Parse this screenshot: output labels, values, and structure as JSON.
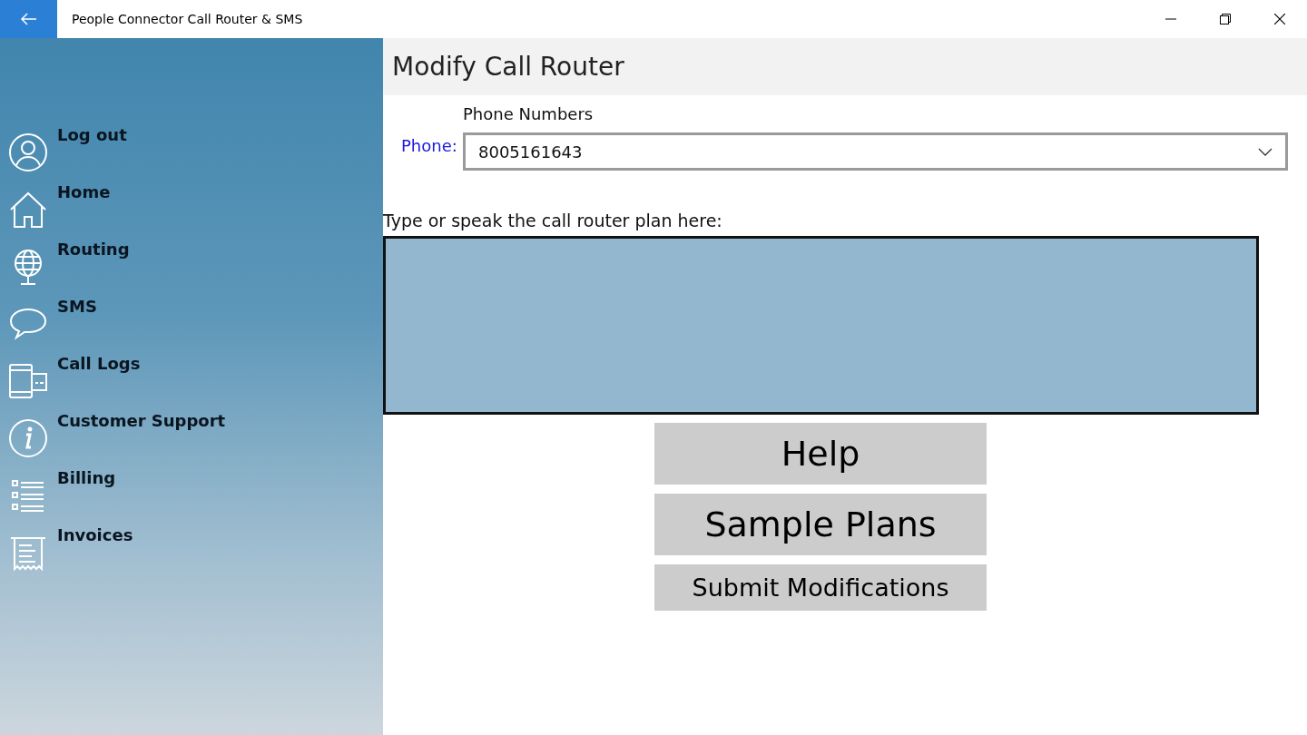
{
  "window": {
    "title": "People Connector Call Router & SMS"
  },
  "sidebar": {
    "items": [
      {
        "label": "Log out"
      },
      {
        "label": "Home"
      },
      {
        "label": "Routing"
      },
      {
        "label": "SMS"
      },
      {
        "label": "Call Logs"
      },
      {
        "label": "Customer Support"
      },
      {
        "label": "Billing"
      },
      {
        "label": "Invoices"
      }
    ]
  },
  "page": {
    "title": "Modify Call Router"
  },
  "phone": {
    "label": "Phone:",
    "dropdown_label": "Phone Numbers",
    "value": "8005161643"
  },
  "plan": {
    "prompt": "Type or speak the call router plan here:"
  },
  "buttons": [
    {
      "label": "Help",
      "kind": "large"
    },
    {
      "label": "Sample Plans",
      "kind": "large"
    },
    {
      "label": "Submit Modifications",
      "kind": "medium"
    }
  ]
}
